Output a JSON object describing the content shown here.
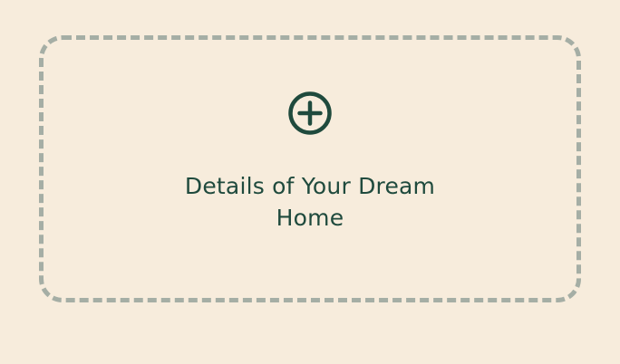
{
  "add_card": {
    "icon": "plus-circle-icon",
    "label": "Details of Your Dream Home"
  },
  "colors": {
    "background": "#f7ecdc",
    "accent": "#1f4a3d",
    "border": "#a5aea5"
  }
}
